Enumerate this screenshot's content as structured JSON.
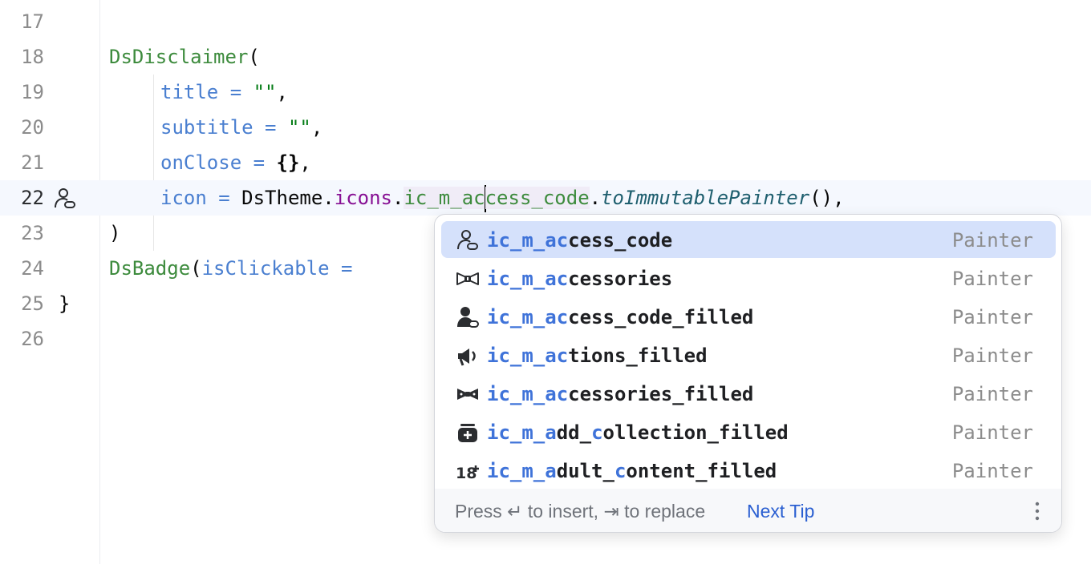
{
  "editor": {
    "lines": [
      {
        "num": "17"
      },
      {
        "num": "18",
        "tokens": [
          {
            "t": "DsDisclaimer",
            "c": "fn"
          },
          {
            "t": "("
          }
        ]
      },
      {
        "num": "19",
        "tokens": [
          {
            "t": "title",
            "c": "param"
          },
          {
            "t": " = ",
            "c": "param"
          },
          {
            "t": "\"\"",
            "c": "str"
          },
          {
            "t": ","
          }
        ]
      },
      {
        "num": "20",
        "tokens": [
          {
            "t": "subtitle",
            "c": "param"
          },
          {
            "t": " = ",
            "c": "param"
          },
          {
            "t": "\"\"",
            "c": "str"
          },
          {
            "t": ","
          }
        ]
      },
      {
        "num": "21",
        "tokens": [
          {
            "t": "onClose",
            "c": "param"
          },
          {
            "t": " = ",
            "c": "param"
          },
          {
            "t": "{}",
            "c": "bold"
          },
          {
            "t": ","
          }
        ]
      },
      {
        "num": "22",
        "current": true,
        "tokens": [
          {
            "t": "icon",
            "c": "param"
          },
          {
            "t": " = ",
            "c": "param"
          },
          {
            "t": "DsTheme."
          },
          {
            "t": "icons",
            "c": "field"
          },
          {
            "t": "."
          },
          {
            "t": "ic_m_ac",
            "c": "hl"
          },
          {
            "caret": true
          },
          {
            "t": "cess_code",
            "c": "hl"
          },
          {
            "t": "."
          },
          {
            "t": "toImmutablePainter",
            "c": "ital"
          },
          {
            "t": "(),"
          }
        ]
      },
      {
        "num": "23",
        "tokens": [
          {
            "t": ")"
          }
        ]
      },
      {
        "num": "24",
        "tokens": [
          {
            "t": "DsBadge",
            "c": "fn"
          },
          {
            "t": "("
          },
          {
            "t": "isClickable",
            "c": "param"
          },
          {
            "t": " = ",
            "c": "param"
          }
        ]
      },
      {
        "num": "25",
        "tokens": [
          {
            "t": "}"
          }
        ]
      },
      {
        "num": "26"
      }
    ]
  },
  "completion": {
    "items": [
      {
        "icon": "person-link-icon",
        "match": "ic_m_ac",
        "rest": "cess_code",
        "type": "Painter",
        "selected": true
      },
      {
        "icon": "bow-tie-icon",
        "match": "ic_m_ac",
        "rest": "cessories",
        "type": "Painter"
      },
      {
        "icon": "person-filled-icon",
        "match": "ic_m_ac",
        "rest": "cess_code_filled",
        "type": "Painter"
      },
      {
        "icon": "megaphone-icon",
        "match": "ic_m_ac",
        "rest": "tions_filled",
        "type": "Painter"
      },
      {
        "icon": "bow-tie-filled-icon",
        "match": "ic_m_ac",
        "rest": "cessories_filled",
        "type": "Painter"
      },
      {
        "icon": "collection-add-icon",
        "parts": [
          {
            "t": "ic_m_a",
            "m": true
          },
          {
            "t": "dd_"
          },
          {
            "t": "c",
            "m": true
          },
          {
            "t": "ollection_filled"
          }
        ],
        "type": "Painter"
      },
      {
        "icon": "adult-18-icon",
        "parts": [
          {
            "t": "ic_m_a",
            "m": true
          },
          {
            "t": "dult_"
          },
          {
            "t": "c",
            "m": true
          },
          {
            "t": "ontent_filled"
          }
        ],
        "type": "Painter"
      }
    ],
    "footer": {
      "hint": "Press ↵ to insert, ⇥ to replace",
      "tip": "Next Tip"
    }
  }
}
